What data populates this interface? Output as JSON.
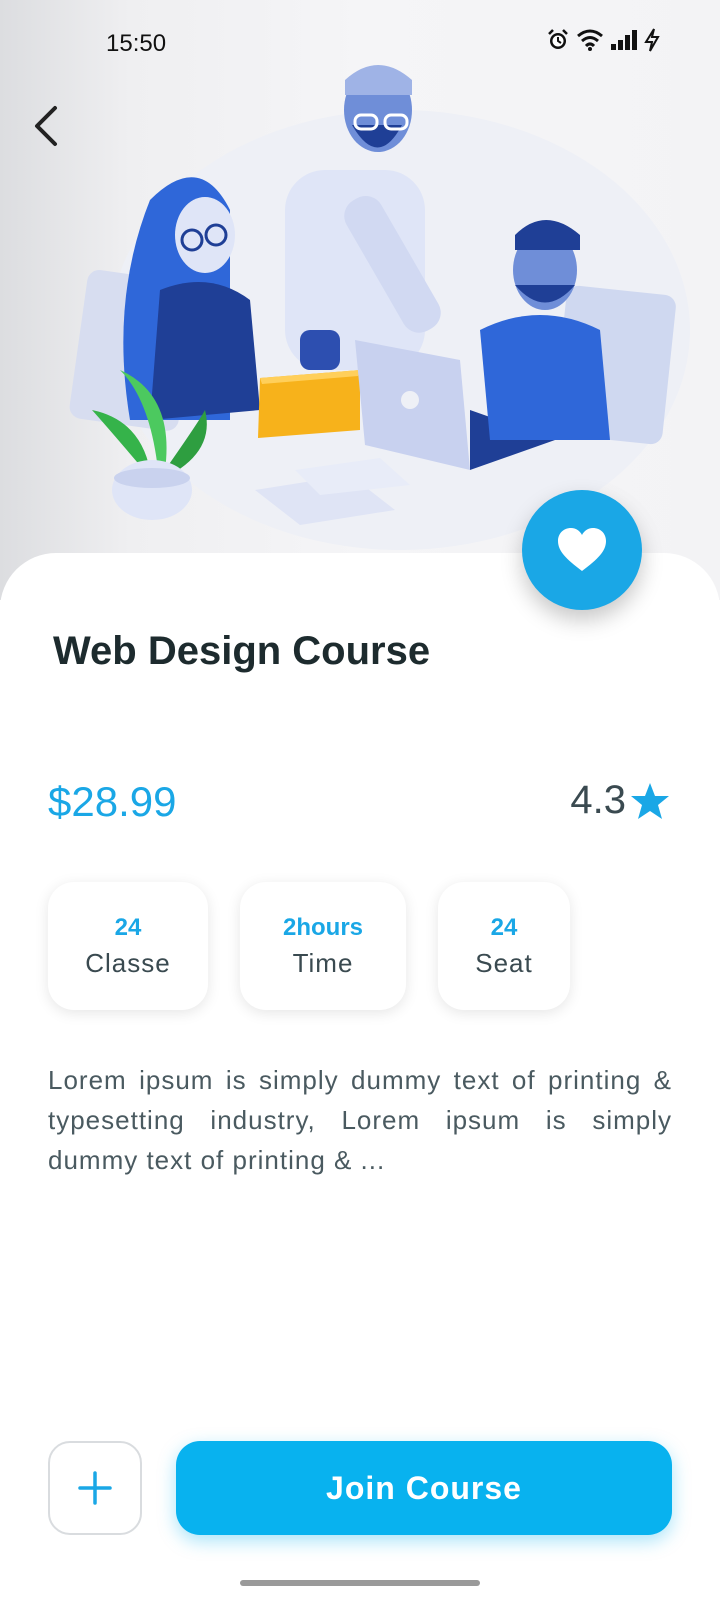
{
  "status_bar": {
    "time": "15:50"
  },
  "course": {
    "title": "Web Design Course",
    "price": "$28.99",
    "rating": "4.3",
    "stats": [
      {
        "value": "24",
        "label": "Classe"
      },
      {
        "value": "2hours",
        "label": "Time"
      },
      {
        "value": "24",
        "label": "Seat"
      }
    ],
    "description": "Lorem ipsum is simply dummy text of printing & typesetting industry, Lorem ipsum is simply dummy text of printing & ..."
  },
  "actions": {
    "add_icon": "plus-icon",
    "join_label": "Join Course"
  },
  "colors": {
    "accent": "#1aa7e6",
    "button": "#08b2ef",
    "title": "#1d2b2e",
    "text": "#4a5a60"
  },
  "icons": {
    "back": "chevron-left-icon",
    "favorite": "heart-icon",
    "rating": "star-icon"
  }
}
